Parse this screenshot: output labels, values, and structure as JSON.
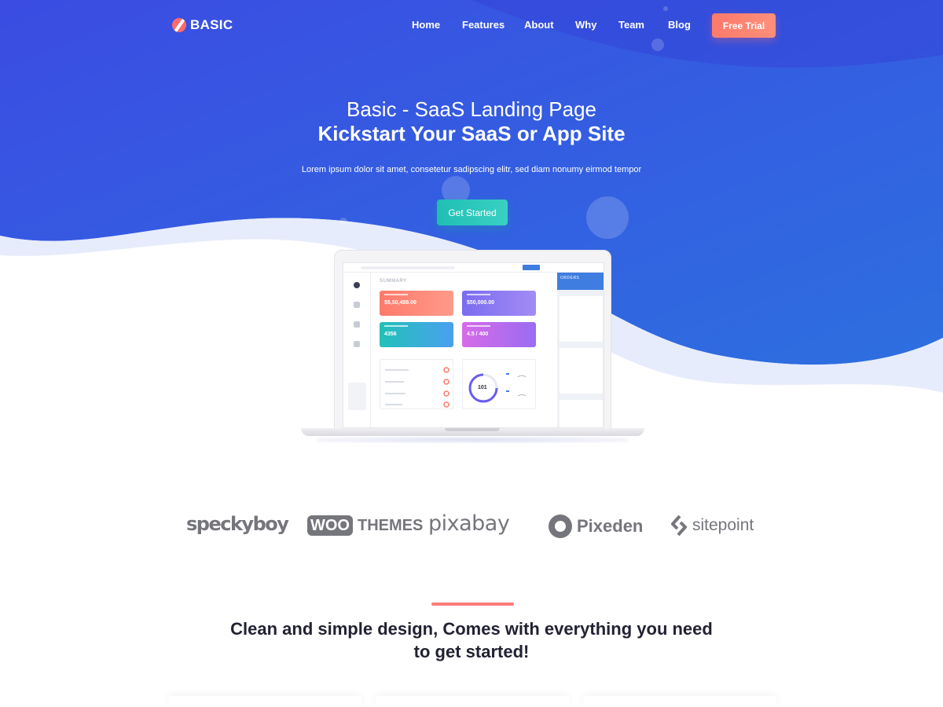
{
  "brand": {
    "name": "BASIC",
    "accent": "#ff6b6b"
  },
  "nav": {
    "items": [
      {
        "label": "Home"
      },
      {
        "label": "Features"
      },
      {
        "label": "About"
      },
      {
        "label": "Why"
      },
      {
        "label": "Team"
      },
      {
        "label": "Blog"
      }
    ],
    "cta_label": "Free Trial"
  },
  "hero": {
    "title": "Basic - SaaS Landing Page",
    "subtitle": "Kickstart Your SaaS or App Site",
    "description": "Lorem ipsum dolor sit amet, consetetur sadipscing elitr, sed diam nonumy eirmod tempor",
    "button_label": "Get Started",
    "bg_color_start": "#3a4fe0",
    "bg_color_end": "#2f6be0"
  },
  "mockup": {
    "summary_label": "SUMMARY",
    "orders_label": "ORDERS",
    "stats": [
      {
        "value": "$5,50,488.00",
        "color": "#ff7a6b"
      },
      {
        "value": "$50,000.00",
        "color": "#7b6cf0"
      },
      {
        "value": "4356",
        "color": "#2ec4c4"
      },
      {
        "value": "4.5 / 400",
        "color": "#c56df0"
      }
    ],
    "donut_value": "101"
  },
  "brands": [
    {
      "name": "speckyboy"
    },
    {
      "name": "WOO",
      "suffix": "THEMES"
    },
    {
      "name": "pixabay"
    },
    {
      "name": "Pixeden"
    },
    {
      "name": "sitepoint"
    }
  ],
  "section": {
    "title_bold": "Clean and simple design,",
    "title_rest": " Comes with everything you need to get started!"
  }
}
